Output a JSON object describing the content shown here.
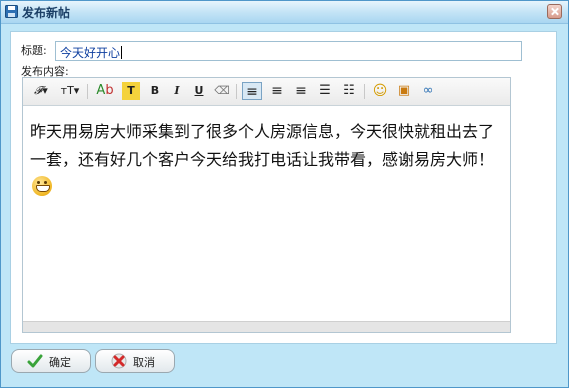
{
  "window": {
    "title": "发布新帖"
  },
  "form": {
    "title_label": "标题:",
    "title_value": "今天好开心",
    "content_label": "发布内容:",
    "content_text": "昨天用易房大师采集到了很多个人房源信息，今天很快就租出去了一套，还有好几个客户今天给我打电话让我带看，感谢易房大师！"
  },
  "toolbar": {
    "items": [
      {
        "name": "font-family-icon",
        "glyph": "𝓕▾"
      },
      {
        "name": "font-size-icon",
        "glyph": "тТ▾"
      },
      {
        "name": "text-color-icon",
        "glyph": "Ab"
      },
      {
        "name": "highlight-icon",
        "glyph": "T"
      },
      {
        "name": "bold-icon",
        "glyph": "B"
      },
      {
        "name": "italic-icon",
        "glyph": "I"
      },
      {
        "name": "underline-icon",
        "glyph": "U"
      },
      {
        "name": "eraser-icon",
        "glyph": "⌫"
      },
      {
        "name": "align-left-icon",
        "glyph": "≡"
      },
      {
        "name": "align-center-icon",
        "glyph": "≡"
      },
      {
        "name": "align-right-icon",
        "glyph": "≡"
      },
      {
        "name": "ordered-list-icon",
        "glyph": "☰"
      },
      {
        "name": "unordered-list-icon",
        "glyph": "☷"
      },
      {
        "name": "emoticon-icon",
        "glyph": "☺"
      },
      {
        "name": "insert-image-icon",
        "glyph": "▣"
      },
      {
        "name": "insert-link-icon",
        "glyph": "∞"
      }
    ]
  },
  "buttons": {
    "ok": "确定",
    "cancel": "取消"
  },
  "colors": {
    "accent": "#4f97c9",
    "dialog_bg": "#bfe6f7",
    "link_text": "#1040a0"
  }
}
